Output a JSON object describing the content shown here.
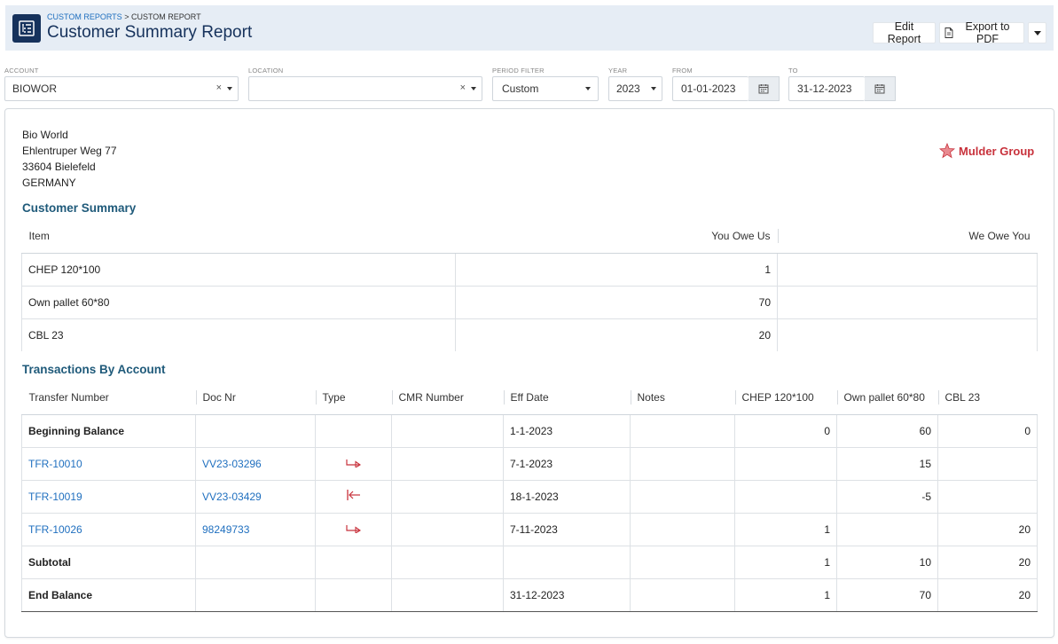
{
  "header": {
    "breadcrumb_link": "CUSTOM REPORTS",
    "breadcrumb_sep": " > ",
    "breadcrumb_current": "CUSTOM REPORT",
    "title": "Customer Summary Report",
    "edit_label": "Edit Report",
    "export_label": "Export to PDF"
  },
  "filters": {
    "account": {
      "label": "ACCOUNT",
      "value": "BIOWOR"
    },
    "location": {
      "label": "LOCATION",
      "value": ""
    },
    "period": {
      "label": "PERIOD FILTER",
      "value": "Custom"
    },
    "year": {
      "label": "YEAR",
      "value": "2023"
    },
    "from": {
      "label": "FROM",
      "value": "01-01-2023"
    },
    "to": {
      "label": "TO",
      "value": "31-12-2023"
    }
  },
  "customer": {
    "name": "Bio World",
    "street": "Ehlentruper Weg 77",
    "city": "33604 Bielefeld",
    "country": "GERMANY"
  },
  "logo_text": "Mulder Group",
  "summary": {
    "title": "Customer Summary",
    "headers": [
      "Item",
      "You Owe Us",
      "We Owe You"
    ],
    "rows": [
      [
        "CHEP 120*100",
        "1",
        ""
      ],
      [
        "Own pallet 60*80",
        "70",
        ""
      ],
      [
        "CBL 23",
        "20",
        ""
      ]
    ]
  },
  "transactions": {
    "title": "Transactions By Account",
    "headers": [
      "Transfer Number",
      "Doc Nr",
      "Type",
      "CMR Number",
      "Eff Date",
      "Notes",
      "CHEP 120*100",
      "Own pallet 60*80",
      "CBL 23"
    ],
    "rows": [
      {
        "transfer": "Beginning Balance",
        "doc": "",
        "type": "",
        "cmr": "",
        "date": "1-1-2023",
        "notes": "",
        "chep": "0",
        "own": "60",
        "cbl": "0"
      },
      {
        "transfer": "TFR-10010",
        "doc": "VV23-03296",
        "type": "outgoing",
        "cmr": "",
        "date": "7-1-2023",
        "notes": "",
        "chep": "",
        "own": "15",
        "cbl": ""
      },
      {
        "transfer": "TFR-10019",
        "doc": "VV23-03429",
        "type": "incoming",
        "cmr": "",
        "date": "18-1-2023",
        "notes": "",
        "chep": "",
        "own": "-5",
        "cbl": ""
      },
      {
        "transfer": "TFR-10026",
        "doc": "98249733",
        "type": "outgoing",
        "cmr": "",
        "date": "7-11-2023",
        "notes": "",
        "chep": "1",
        "own": "",
        "cbl": "20"
      },
      {
        "transfer": "Subtotal",
        "doc": "",
        "type": "",
        "cmr": "",
        "date": "",
        "notes": "",
        "chep": "1",
        "own": "10",
        "cbl": "20"
      },
      {
        "transfer": "End Balance",
        "doc": "",
        "type": "",
        "cmr": "",
        "date": "31-12-2023",
        "notes": "",
        "chep": "1",
        "own": "70",
        "cbl": "20"
      }
    ]
  },
  "colors": {
    "header_bg": "#e6edf5",
    "title": "#16325c",
    "link": "#1f6fbf",
    "section_title": "#1f5a7a",
    "type_arrow": "#c8323c",
    "logo": "#c8323c"
  }
}
